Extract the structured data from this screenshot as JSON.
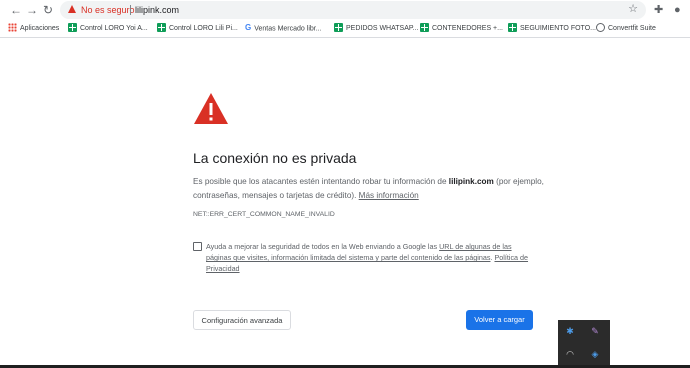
{
  "toolbar": {
    "back_glyph": "←",
    "forward_glyph": "→",
    "reload_glyph": "↻",
    "security_label": "No es seguro",
    "url": "lilipink.com",
    "star_glyph": "☆",
    "extensions_glyph": "✚",
    "profile_glyph": "●"
  },
  "bookmarks": [
    {
      "label": "Aplicaciones",
      "icon": "apps-grid-icon"
    },
    {
      "label": "Control LORO Yoi A...",
      "icon": "sheets-icon"
    },
    {
      "label": "Control LORO Lili Pi...",
      "icon": "sheets-icon"
    },
    {
      "label": "Ventas Mercado libr...",
      "icon": "google-icon"
    },
    {
      "label": "PEDIDOS WHATSAP...",
      "icon": "sheets-icon"
    },
    {
      "label": "CONTENEDORES +...",
      "icon": "sheets-icon"
    },
    {
      "label": "SEGUIMIENTO FOTO...",
      "icon": "sheets-icon"
    },
    {
      "label": "Convertfit Suite",
      "icon": "globe-icon"
    }
  ],
  "interstitial": {
    "title": "La conexión no es privada",
    "body_before": "Es posible que los atacantes estén intentando robar tu información de ",
    "domain": "lilipink.com",
    "body_after": " (por ejemplo, contraseñas, mensajes o tarjetas de crédito). ",
    "more_info": "Más información",
    "error_code": "NET::ERR_CERT_COMMON_NAME_INVALID",
    "report_before": "Ayuda a mejorar la seguridad de todos en la Web enviando a Google las ",
    "report_link1": "URL de algunas de las páginas que visites, información limitada del sistema y parte del contenido de las páginas",
    "report_mid": ". ",
    "report_link2": "Política de Privacidad",
    "report_checked": false,
    "advanced_button": "Configuración avanzada",
    "reload_button": "Volver a cargar"
  },
  "tray": {
    "icons": [
      "bluetooth-icon",
      "pen-icon",
      "wifi-icon",
      "shield-icon"
    ]
  },
  "colors": {
    "danger": "#d93025",
    "primary": "#1a73e8",
    "text": "#202124",
    "secondary_text": "#5f6368"
  }
}
